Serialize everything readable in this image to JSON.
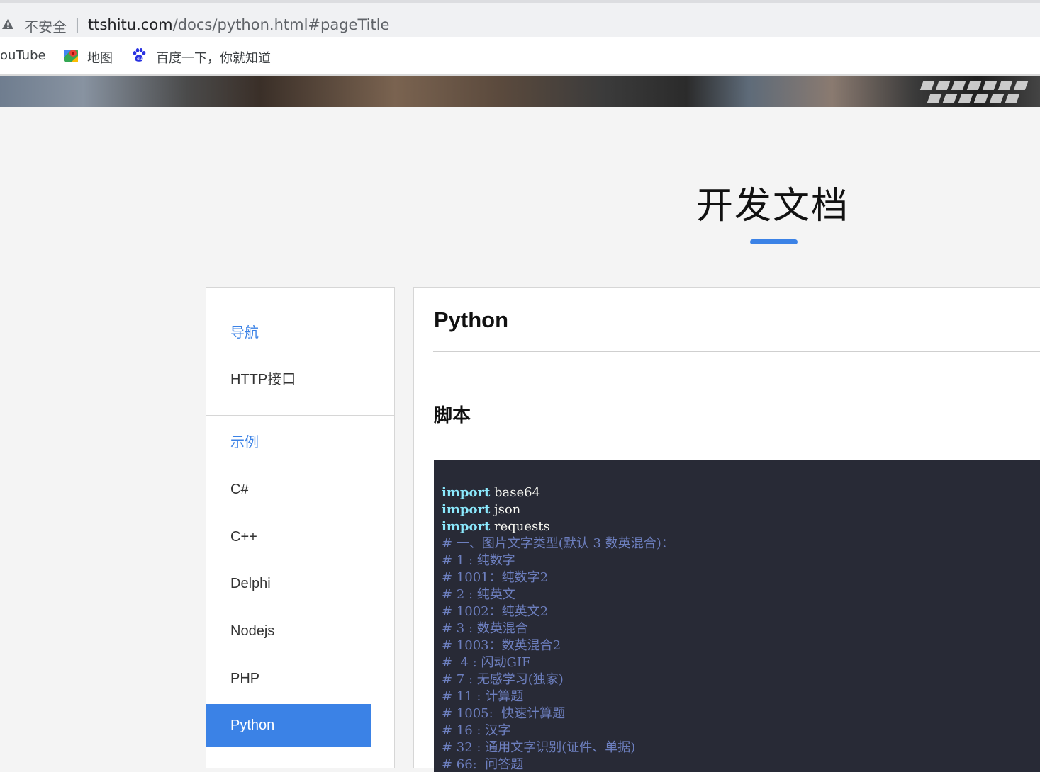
{
  "browser": {
    "security_label": "不安全",
    "separator": "|",
    "url_host": "ttshitu.com",
    "url_path": "/docs/python.html#pageTitle"
  },
  "bookmarks": [
    {
      "label": "ouTube",
      "icon": "youtube-icon"
    },
    {
      "label": "地图",
      "icon": "maps-icon"
    },
    {
      "label": "百度一下，你就知道",
      "icon": "baidu-paw-icon"
    }
  ],
  "page": {
    "title": "开发文档",
    "accent_color": "#3b82e6"
  },
  "sidebar": {
    "nav_heading": "导航",
    "nav_items": [
      "HTTP接口"
    ],
    "examples_heading": "示例",
    "example_items": [
      "C#",
      "C++",
      "Delphi",
      "Nodejs",
      "PHP",
      "Python"
    ],
    "active_item": "Python"
  },
  "main": {
    "title": "Python",
    "section_title": "脚本",
    "code_lines": [
      {
        "kw": "import",
        "text": " base64"
      },
      {
        "kw": "import",
        "text": " json"
      },
      {
        "kw": "import",
        "text": " requests"
      },
      {
        "comment": "# 一、图片文字类型(默认 3 数英混合)："
      },
      {
        "comment": "# 1 : 纯数字"
      },
      {
        "comment": "# 1001：纯数字2"
      },
      {
        "comment": "# 2 : 纯英文"
      },
      {
        "comment": "# 1002：纯英文2"
      },
      {
        "comment": "# 3 : 数英混合"
      },
      {
        "comment": "# 1003：数英混合2"
      },
      {
        "comment": "#  4 : 闪动GIF"
      },
      {
        "comment": "# 7 : 无感学习(独家)"
      },
      {
        "comment": "# 11 : 计算题"
      },
      {
        "comment": "# 1005:  快速计算题"
      },
      {
        "comment": "# 16 : 汉字"
      },
      {
        "comment": "# 32 : 通用文字识别(证件、单据)"
      },
      {
        "comment": "# 66:  问答题"
      }
    ]
  }
}
